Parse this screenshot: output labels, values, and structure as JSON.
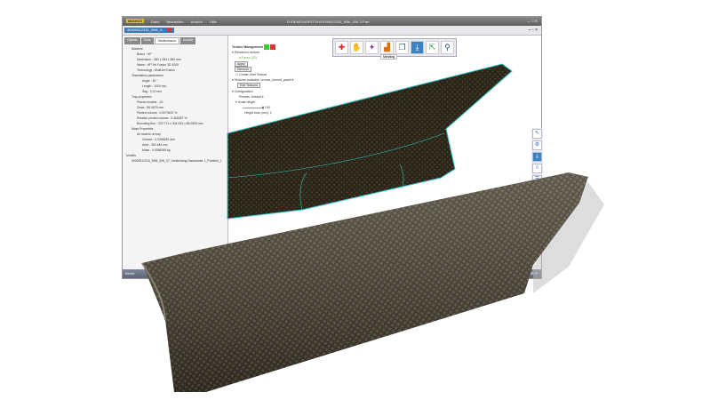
{
  "app": {
    "logo": "MAGICS",
    "menu": [
      "Datei",
      "Bearbeiten",
      "Ansicht",
      "Hilfe"
    ],
    "title": "D:\\DEMO\\AGROTHV\\3000512315_90M_30K.3.Part",
    "window_controls": [
      "—",
      "□",
      "✕"
    ]
  },
  "document_tab": {
    "label": "30000512315_90M_3..."
  },
  "left_panel": {
    "tabs": [
      "Objekte",
      "Tools",
      "Strukturbaum",
      "Ansicht"
    ],
    "active_tab": 2,
    "tree": [
      {
        "level": 1,
        "text": "Machine"
      },
      {
        "level": 2,
        "text": "Brand : HP"
      },
      {
        "level": 2,
        "text": "Dimension : 380 x 284 x 380 mm"
      },
      {
        "level": 2,
        "text": "Name : HP Jet Fusion 3D 4200"
      },
      {
        "level": 2,
        "text": "Technology : MultiJet Fusion"
      },
      {
        "level": 1,
        "text": "Tessellation parameters"
      },
      {
        "level": 3,
        "text": "Angle : 45 °"
      },
      {
        "level": 3,
        "text": "Length : 1000 mm"
      },
      {
        "level": 3,
        "text": "Sag : 0.02 mm"
      },
      {
        "level": 1,
        "text": "Tray properties"
      },
      {
        "level": 2,
        "text": "Placed models : 1/1"
      },
      {
        "level": 2,
        "text": "Zmax : 86.0676 mm"
      },
      {
        "level": 2,
        "text": "Printed volume : 0.0073637 %"
      },
      {
        "level": 2,
        "text": "Relative printed volume : 0.365267 %"
      },
      {
        "level": 2,
        "text": "Bounding Box : 322.774 x 304.053 x 86.0553 mm"
      },
      {
        "level": 1,
        "text": "Mass Properties"
      },
      {
        "level": 2,
        "text": "All models on tray"
      },
      {
        "level": 3,
        "text": "Volume : 0.0398285 dm³"
      },
      {
        "level": 3,
        "text": "Area : 302.484 cm²"
      },
      {
        "level": 3,
        "text": "Mass : 0.0398285 kg"
      },
      {
        "level": 0,
        "text": "Models"
      },
      {
        "level": 1,
        "text": "30000512315_90M_30K_07_Verkleidung Dachkanter 1_Portfolio_1"
      }
    ]
  },
  "texture_panel": {
    "title": "Texture Management",
    "element_to_texture": "Element to texture",
    "face_status": "Faces (32)",
    "apply": "Apply",
    "remove": "Remove",
    "create_user_texture": "Create User Texture",
    "textures_available": "Textures available: bronze_formed_panel",
    "edit_textures": "Edit Textures",
    "configuration": "Configuration",
    "presets": "Presets: Default",
    "scale_height": "Scale height",
    "slider_value": "100",
    "height_max": "Height max (mm): 2"
  },
  "toolbar": {
    "tooltip": "Meshing",
    "icons": [
      "add-icon",
      "hand-icon",
      "star-icon",
      "signal-icon",
      "copy-icon",
      "download-icon",
      "export-icon",
      "tool-icon"
    ],
    "selected": 5
  },
  "right_toolbar": {
    "icons": [
      "cursor-icon",
      "gear-icon",
      "download-icon",
      "import-icon",
      "layers-icon"
    ],
    "selected": 2
  },
  "status": {
    "left": "Bereit"
  },
  "colors": {
    "texture_dark": "#2e2a20",
    "outline": "#2ec4c4",
    "accent": "#3b82c4"
  }
}
